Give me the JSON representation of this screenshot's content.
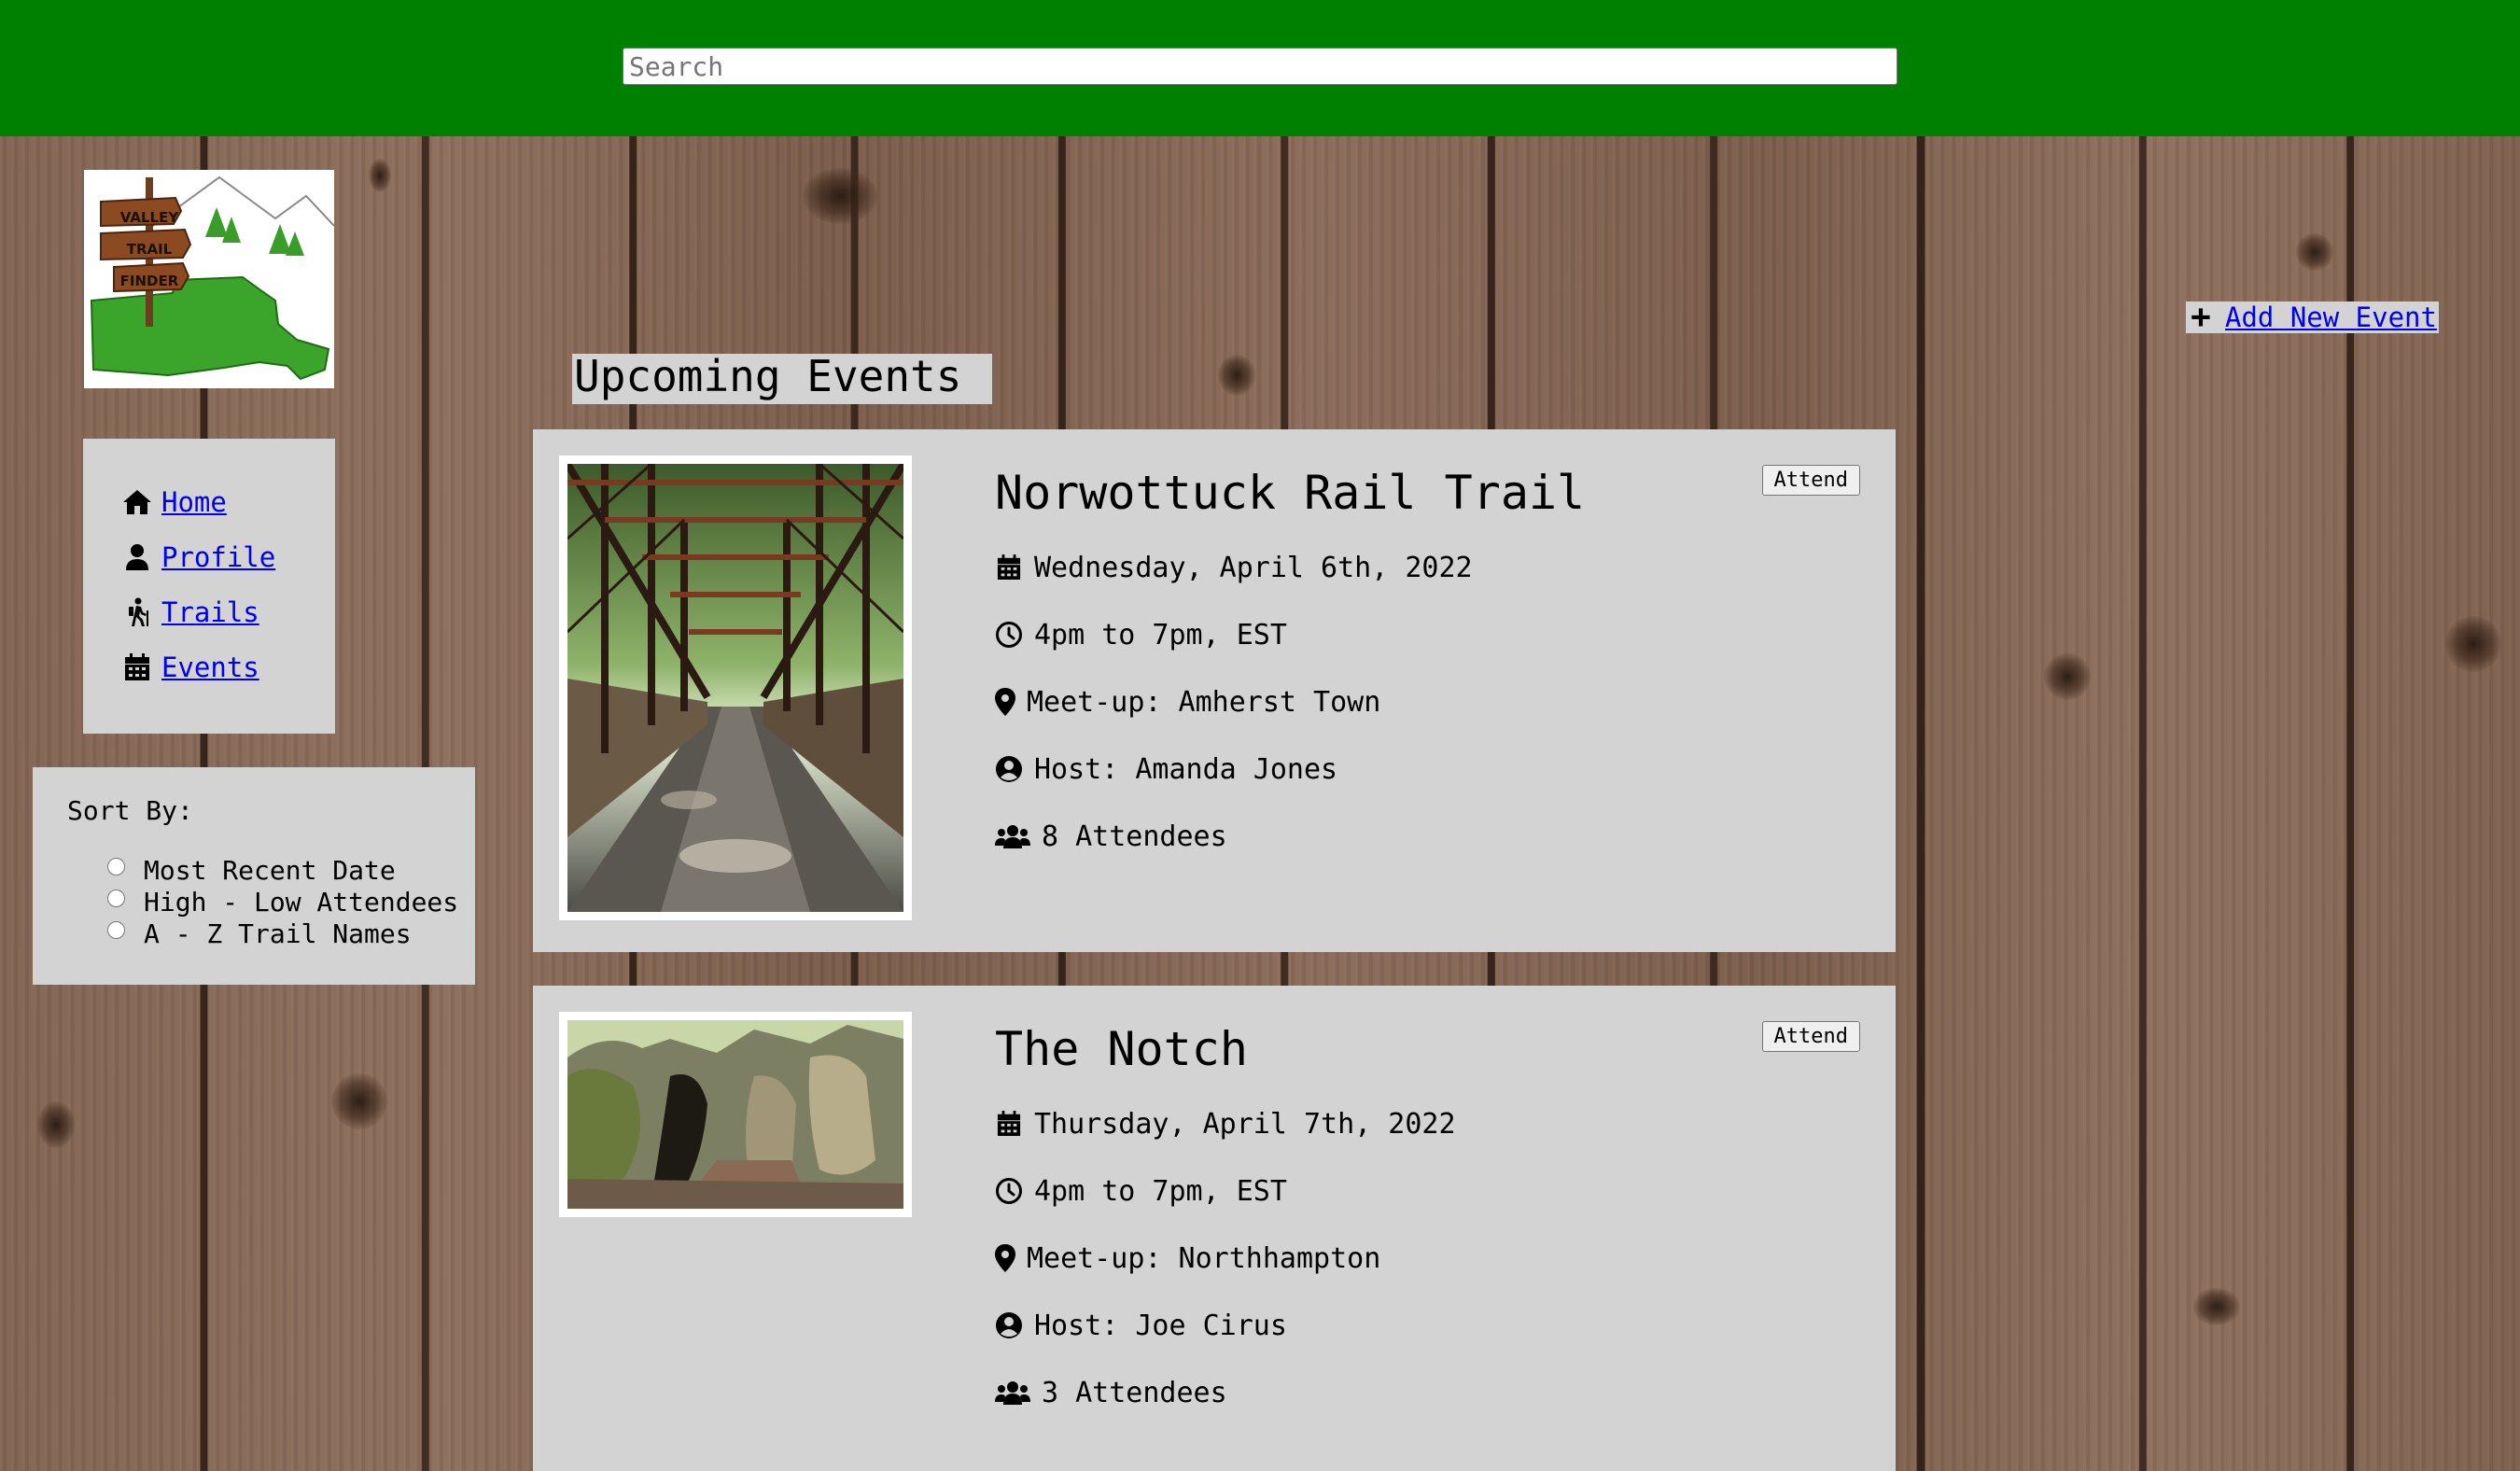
{
  "search": {
    "placeholder": "Search"
  },
  "logo": {
    "lines": [
      "VALLEY",
      "TRAIL",
      "FINDER"
    ]
  },
  "nav": {
    "items": [
      {
        "label": "Home",
        "icon": "home-icon"
      },
      {
        "label": "Profile",
        "icon": "user-icon"
      },
      {
        "label": "Trails",
        "icon": "hiker-icon"
      },
      {
        "label": "Events",
        "icon": "calendar-icon"
      }
    ]
  },
  "sort": {
    "title": "Sort By:",
    "options": [
      "Most Recent Date",
      "High - Low Attendees",
      "A - Z Trail Names"
    ]
  },
  "main": {
    "heading": "Upcoming Events",
    "add_event_label": "Add New Event"
  },
  "events": [
    {
      "title": "Norwottuck Rail Trail",
      "date": "Wednesday, April 6th, 2022",
      "time": "4pm to 7pm, EST",
      "meetup": "Meet-up: Amherst Town",
      "host": "Host: Amanda Jones",
      "attendees": "8 Attendees",
      "attend_label": "Attend"
    },
    {
      "title": "The Notch",
      "date": "Thursday, April 7th, 2022",
      "time": "4pm to 7pm, EST",
      "meetup": "Meet-up: Northhampton",
      "host": "Host: Joe Cirus",
      "attendees": "3 Attendees",
      "attend_label": "Attend"
    }
  ],
  "colors": {
    "topbar": "#008000",
    "panel": "#d3d3d3",
    "link": "#0000ee"
  }
}
